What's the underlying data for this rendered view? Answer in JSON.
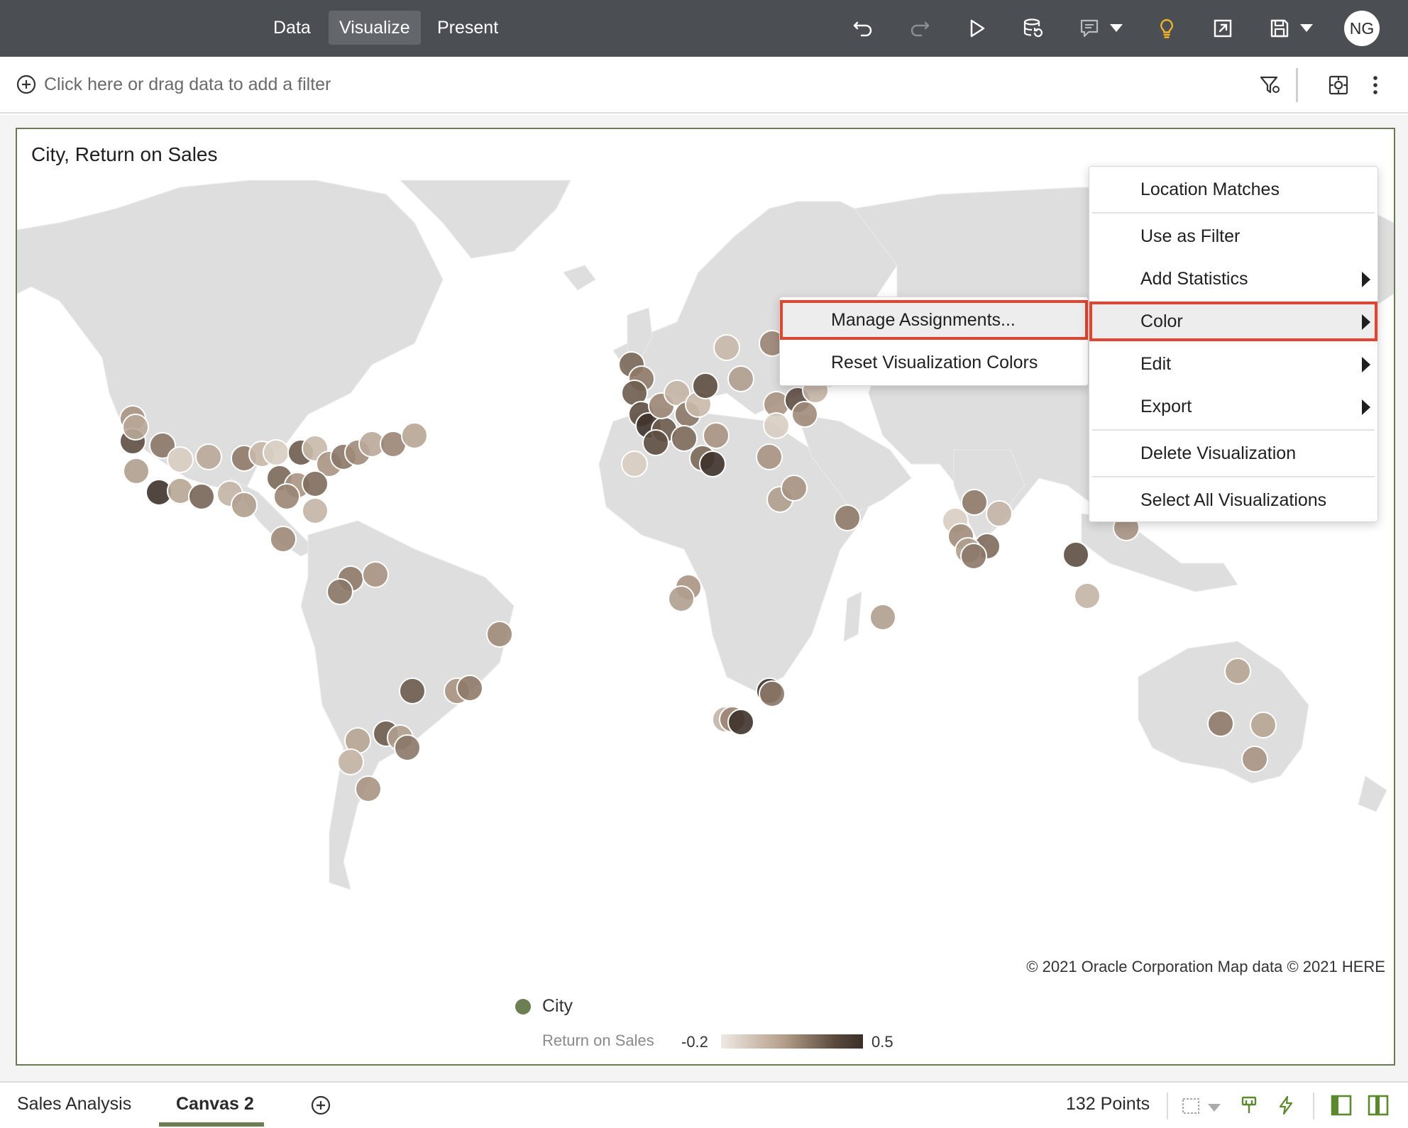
{
  "top_nav": {
    "tabs": [
      "Data",
      "Visualize",
      "Present"
    ],
    "active_tab": "Visualize",
    "user_initials": "NG",
    "icons": [
      "undo-icon",
      "redo-icon",
      "preview-play-icon",
      "refresh-data-icon",
      "comments-icon",
      "insights-lightbulb-icon",
      "export-icon",
      "save-icon"
    ]
  },
  "filter_bar": {
    "placeholder": "Click here or drag data to add a filter",
    "icons": [
      "filter-settings-icon",
      "canvas-properties-icon",
      "more-options-icon"
    ]
  },
  "visualization": {
    "title": "City, Return on Sales",
    "copyright": "© 2021 Oracle Corporation   Map data © 2021 HERE",
    "legend": {
      "city_label": "City",
      "city_color": "#6b7f53",
      "measure_label": "Return on Sales",
      "min_label": "-0.2",
      "max_label": "0.5",
      "gradient_start": "#efe9e3",
      "gradient_end": "#3a2f28"
    },
    "map_land_color": "#dedede",
    "point_count": 132
  },
  "context_menu": {
    "items": [
      {
        "label": "Location Matches",
        "submenu": false
      },
      {
        "label": "Use as Filter",
        "submenu": false
      },
      {
        "label": "Add Statistics",
        "submenu": true
      },
      {
        "label": "Color",
        "submenu": true,
        "highlighted": true
      },
      {
        "label": "Edit",
        "submenu": true
      },
      {
        "label": "Export",
        "submenu": true
      },
      {
        "label": "Delete Visualization",
        "submenu": false
      },
      {
        "label": "Select All Visualizations",
        "submenu": false
      }
    ],
    "color_submenu": [
      {
        "label": "Manage Assignments...",
        "highlighted": true
      },
      {
        "label": "Reset Visualization Colors",
        "highlighted": false
      }
    ],
    "highlight_color": "#e2442f"
  },
  "bottom_bar": {
    "canvas_tabs": [
      "Sales Analysis",
      "Canvas 2"
    ],
    "active_canvas": "Canvas 2",
    "points_label": "132 Points"
  }
}
